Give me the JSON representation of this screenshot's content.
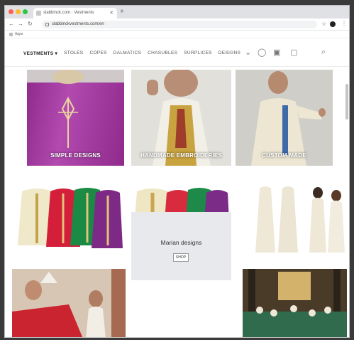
{
  "browser": {
    "tab_title": "slabbinck.com · Vestments",
    "url": "slabbinckvestments.com/en",
    "bookmark": "Apps"
  },
  "site": {
    "menu": [
      "VESTMENTS",
      "STOLES",
      "COPES",
      "DALMATICS",
      "CHASUBLES",
      "SURPLICES",
      "DESIGNS"
    ]
  },
  "tiles": {
    "simple_designs": "SIMPLE DESIGNS",
    "handmade": "HANDMADE EMBROIDERIES",
    "custom": "CUSTOM MADE"
  },
  "marian": {
    "title": "Marian designs",
    "button": "SHOP"
  }
}
